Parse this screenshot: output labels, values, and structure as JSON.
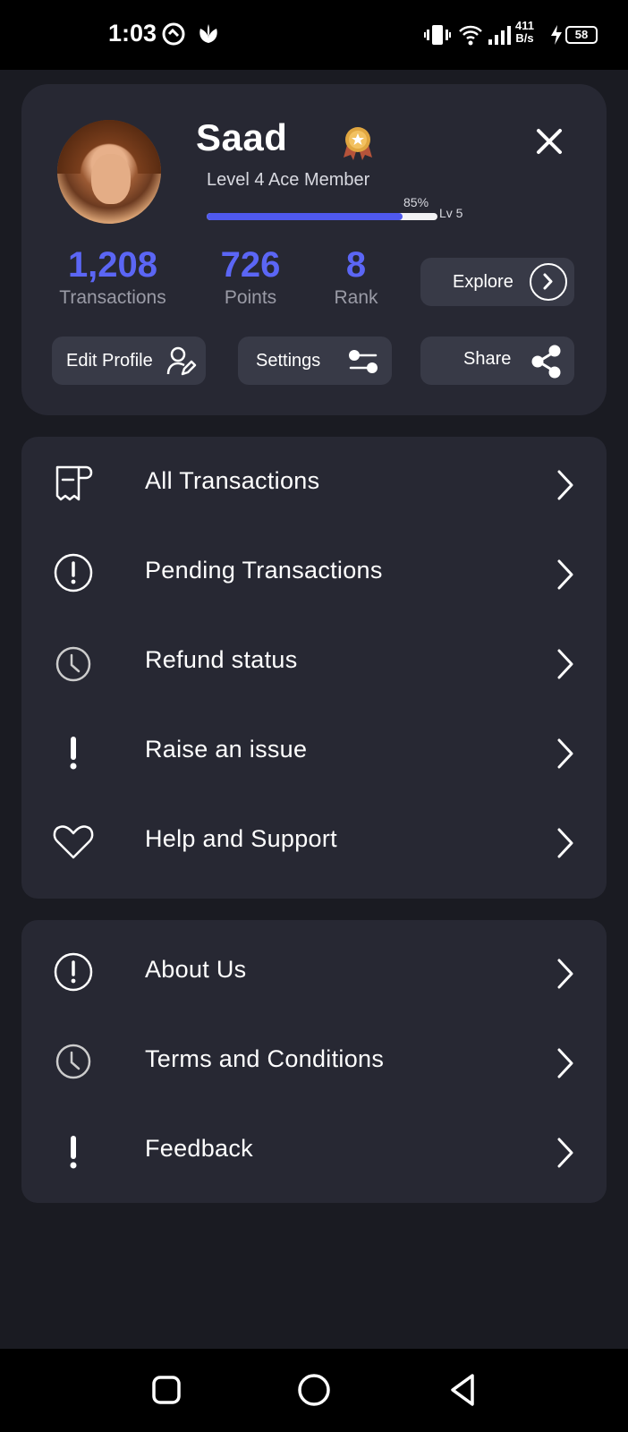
{
  "status_bar": {
    "time": "1:03",
    "speed_value": "411",
    "speed_unit": "B/s",
    "battery": "58",
    "icons": [
      "vpn-icon",
      "sprout-icon",
      "vibrate-icon",
      "wifi-icon",
      "signal-icon",
      "charging-icon",
      "battery-icon"
    ]
  },
  "profile": {
    "name": "Saad",
    "member_level": "Level 4 Ace Member",
    "progress_label": "85%",
    "progress_fraction": 0.85,
    "next_level": "Lv 5"
  },
  "stats": [
    {
      "value": "1,208",
      "label": "Transactions"
    },
    {
      "value": "726",
      "label": "Points"
    },
    {
      "value": "8",
      "label": "Rank"
    }
  ],
  "buttons": {
    "explore": "Explore",
    "edit_profile": "Edit Profile",
    "settings": "Settings",
    "share": "Share"
  },
  "menu_primary": [
    {
      "label": "All Transactions",
      "icon": "receipt-icon"
    },
    {
      "label": "Pending Transactions",
      "icon": "alert-circle-icon"
    },
    {
      "label": "Refund status",
      "icon": "clock-icon"
    },
    {
      "label": "Raise an issue",
      "icon": "exclamation-icon"
    },
    {
      "label": "Help and Support",
      "icon": "heart-icon"
    }
  ],
  "menu_secondary": [
    {
      "label": "About Us",
      "icon": "alert-circle-icon"
    },
    {
      "label": "Terms and Conditions",
      "icon": "clock-icon"
    },
    {
      "label": "Feedback",
      "icon": "exclamation-icon"
    }
  ],
  "colors": {
    "background": "#1a1b22",
    "card": "#272833",
    "accent": "#5b66f5",
    "button": "#383a47",
    "muted_text": "#9a9ba6"
  }
}
